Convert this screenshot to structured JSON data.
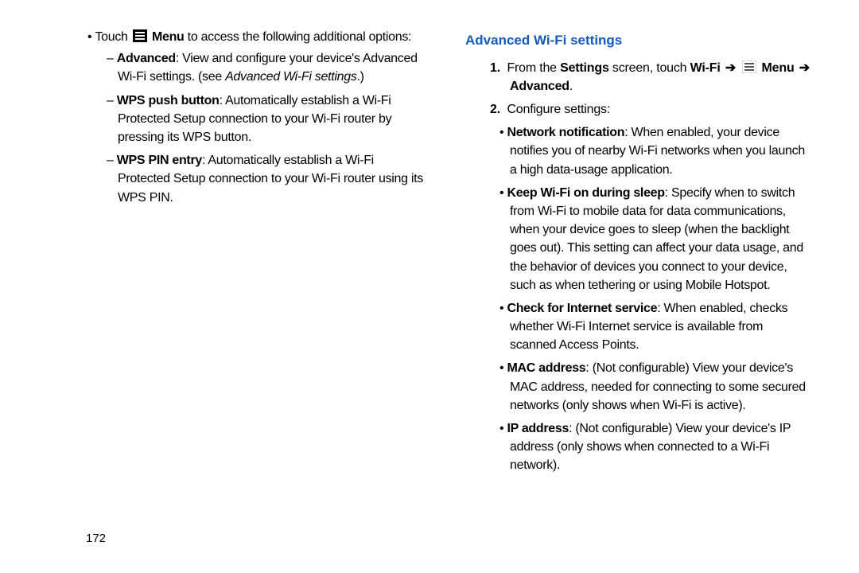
{
  "left": {
    "touch_line_pre": "Touch ",
    "touch_line_menu_bold": " Menu",
    "touch_line_post": " to access the following additional options:",
    "adv_bold": "Advanced",
    "adv_text": ": View and configure your device's Advanced Wi-Fi settings. (see ",
    "adv_xref": "Advanced Wi-Fi settings",
    "adv_close": ".)",
    "wps_push_bold": "WPS push button",
    "wps_push_text": ": Automatically establish a Wi-Fi Protected Setup connection to your Wi-Fi router by pressing its WPS button.",
    "wps_pin_bold": "WPS PIN entry",
    "wps_pin_text": ": Automatically establish a Wi-Fi Protected Setup connection to your Wi-Fi router using its WPS PIN."
  },
  "right": {
    "heading": "Advanced Wi-Fi settings",
    "step1_pre": "From the ",
    "step1_settings": "Settings",
    "step1_mid": " screen, touch ",
    "step1_wifi": "Wi-Fi",
    "step1_menu": " Menu ",
    "step1_advanced": "Advanced",
    "step1_end": ".",
    "step2": "Configure settings:",
    "net_bold": "Network notification",
    "net_text": ": When enabled, your device notifies you of nearby Wi-Fi networks when you launch a high data-usage application.",
    "keep_bold": "Keep Wi-Fi on during sleep",
    "keep_text": ": Specify when to switch from Wi-Fi to mobile data for data communications, when your device goes to sleep (when the backlight goes out). This setting can affect your data usage, and the behavior of devices you connect to your device, such as when tethering or using Mobile Hotspot.",
    "check_bold": "Check for Internet service",
    "check_text": ": When enabled, checks whether Wi-Fi Internet service is available from scanned Access Points.",
    "mac_bold": "MAC address",
    "mac_text": ": (Not configurable) View your device's MAC address, needed for connecting to some secured networks (only shows when Wi-Fi is active).",
    "ip_bold": "IP address",
    "ip_text": ": (Not configurable) View your device's IP address (only shows when connected to a Wi-Fi network)."
  },
  "page_number": "172"
}
